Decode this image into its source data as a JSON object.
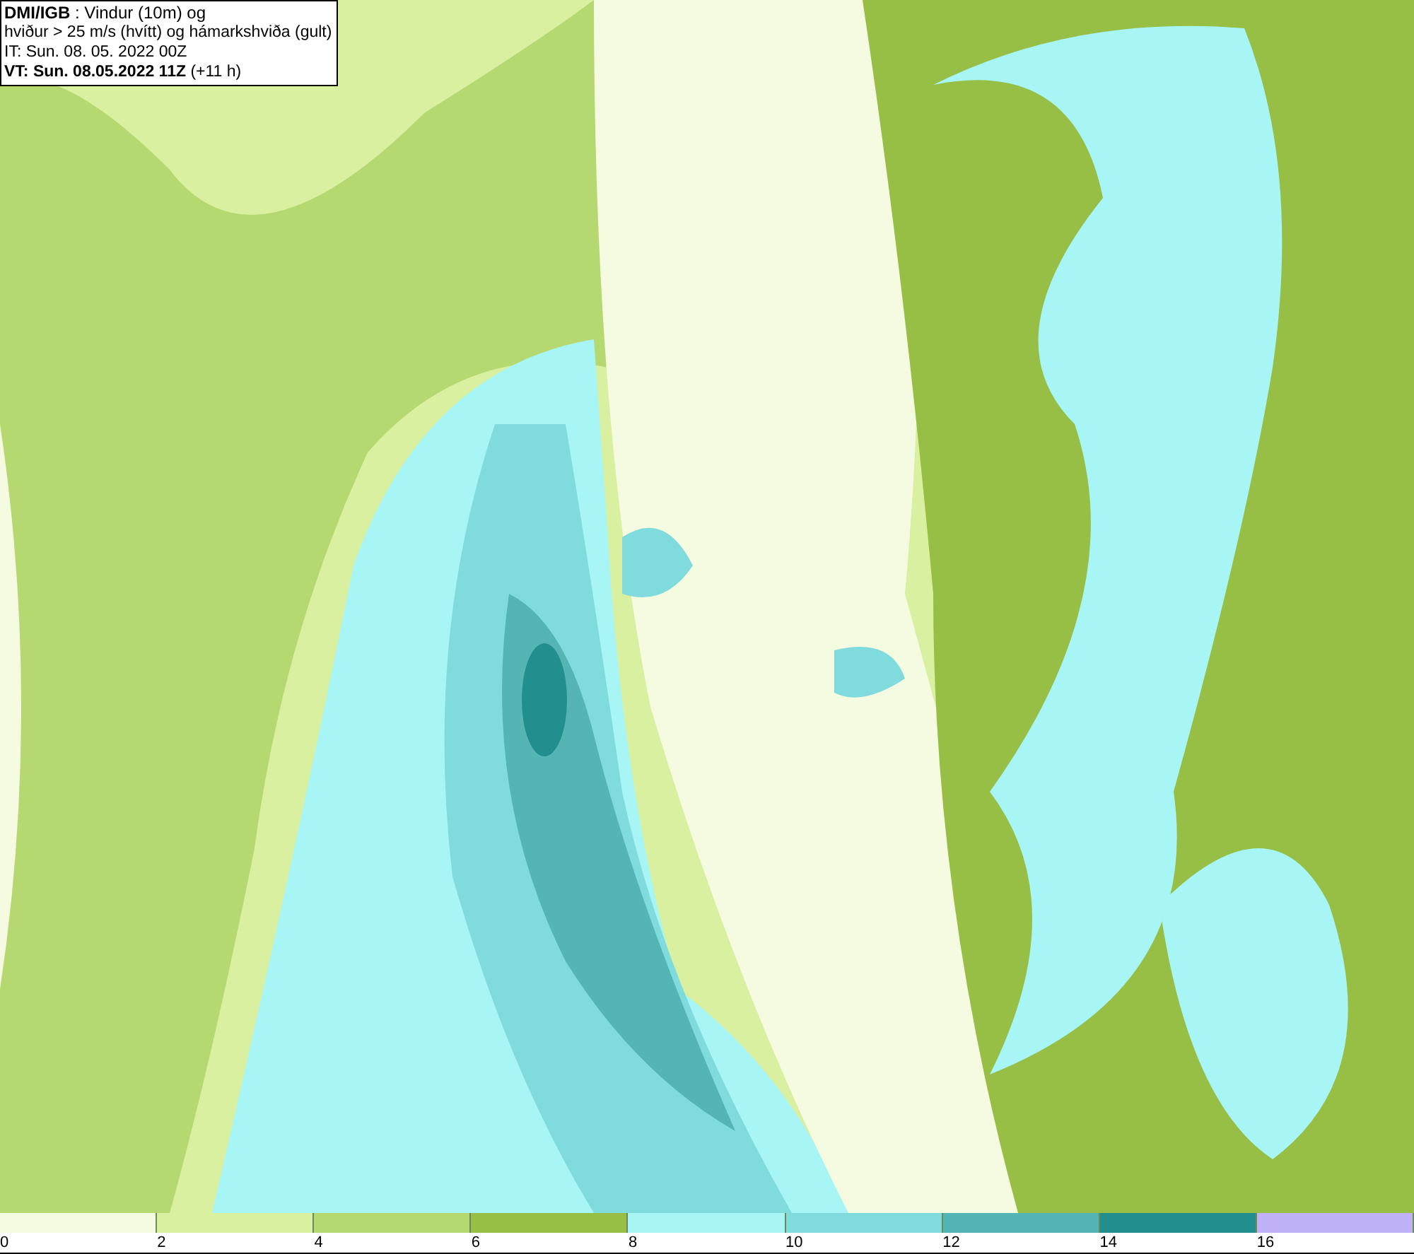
{
  "header": {
    "lines": [
      "**DMI/IGB** : Vindur (10m) og",
      "hviður > 25 m/s (hvítt) og hámarkshviða (gult)",
      "IT: Sun. 08. 05. 2022 00Z",
      "**VT: Sun. 08.05.2022 11Z** (+11 h)"
    ]
  },
  "legend": {
    "bins": [
      {
        "color": "#f5fbe1"
      },
      {
        "color": "#d8f0a0"
      },
      {
        "color": "#b5d870"
      },
      {
        "color": "#97bf45"
      },
      {
        "color": "#a8f5f5"
      },
      {
        "color": "#80dcdc"
      },
      {
        "color": "#55b5b5"
      },
      {
        "color": "#228e8e"
      },
      {
        "color": "#c0b0f5"
      }
    ],
    "ticks": [
      "0",
      "2",
      "4",
      "6",
      "8",
      "10",
      "12",
      "14",
      "16"
    ]
  }
}
